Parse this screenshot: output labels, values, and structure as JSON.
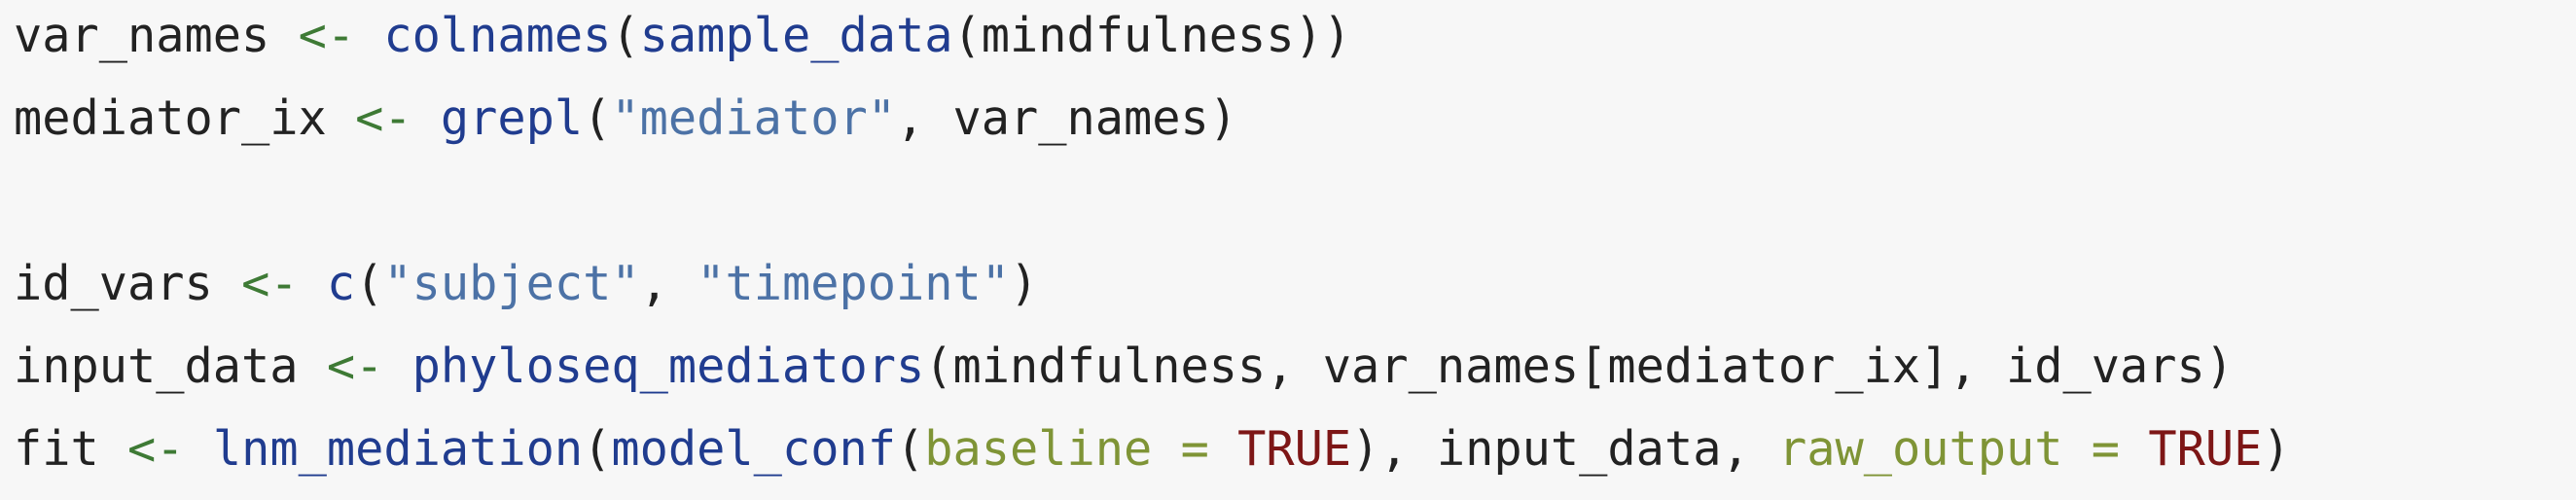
{
  "colors": {
    "background": "#f7f7f7",
    "default_text": "#222222",
    "assign_operator": "#3e7a35",
    "function_name": "#203c8f",
    "string_literal": "#4c72a6",
    "argument_name": "#7f9436",
    "logical_constant": "#7d1616"
  },
  "code_lines": [
    {
      "tokens": [
        {
          "text": "var_names ",
          "type": "plain"
        },
        {
          "text": "<-",
          "type": "operator"
        },
        {
          "text": " ",
          "type": "plain"
        },
        {
          "text": "colnames",
          "type": "function"
        },
        {
          "text": "(",
          "type": "plain"
        },
        {
          "text": "sample_data",
          "type": "function"
        },
        {
          "text": "(mindfulness))",
          "type": "plain"
        }
      ]
    },
    {
      "tokens": [
        {
          "text": "mediator_ix ",
          "type": "plain"
        },
        {
          "text": "<-",
          "type": "operator"
        },
        {
          "text": " ",
          "type": "plain"
        },
        {
          "text": "grepl",
          "type": "function"
        },
        {
          "text": "(",
          "type": "plain"
        },
        {
          "text": "\"mediator\"",
          "type": "string"
        },
        {
          "text": ", var_names)",
          "type": "plain"
        }
      ]
    },
    {
      "tokens": []
    },
    {
      "tokens": [
        {
          "text": "id_vars ",
          "type": "plain"
        },
        {
          "text": "<-",
          "type": "operator"
        },
        {
          "text": " ",
          "type": "plain"
        },
        {
          "text": "c",
          "type": "function"
        },
        {
          "text": "(",
          "type": "plain"
        },
        {
          "text": "\"subject\"",
          "type": "string"
        },
        {
          "text": ", ",
          "type": "plain"
        },
        {
          "text": "\"timepoint\"",
          "type": "string"
        },
        {
          "text": ")",
          "type": "plain"
        }
      ]
    },
    {
      "tokens": [
        {
          "text": "input_data ",
          "type": "plain"
        },
        {
          "text": "<-",
          "type": "operator"
        },
        {
          "text": " ",
          "type": "plain"
        },
        {
          "text": "phyloseq_mediators",
          "type": "function"
        },
        {
          "text": "(mindfulness, var_names[mediator_ix], id_vars)",
          "type": "plain"
        }
      ]
    },
    {
      "tokens": [
        {
          "text": "fit ",
          "type": "plain"
        },
        {
          "text": "<-",
          "type": "operator"
        },
        {
          "text": " ",
          "type": "plain"
        },
        {
          "text": "lnm_mediation",
          "type": "function"
        },
        {
          "text": "(",
          "type": "plain"
        },
        {
          "text": "model_conf",
          "type": "function"
        },
        {
          "text": "(",
          "type": "plain"
        },
        {
          "text": "baseline",
          "type": "argument"
        },
        {
          "text": " ",
          "type": "plain"
        },
        {
          "text": "=",
          "type": "argument"
        },
        {
          "text": " ",
          "type": "plain"
        },
        {
          "text": "TRUE",
          "type": "constant"
        },
        {
          "text": "), input_data, ",
          "type": "plain"
        },
        {
          "text": "raw_output",
          "type": "argument"
        },
        {
          "text": " ",
          "type": "plain"
        },
        {
          "text": "=",
          "type": "argument"
        },
        {
          "text": " ",
          "type": "plain"
        },
        {
          "text": "TRUE",
          "type": "constant"
        },
        {
          "text": ")",
          "type": "plain"
        }
      ]
    }
  ]
}
